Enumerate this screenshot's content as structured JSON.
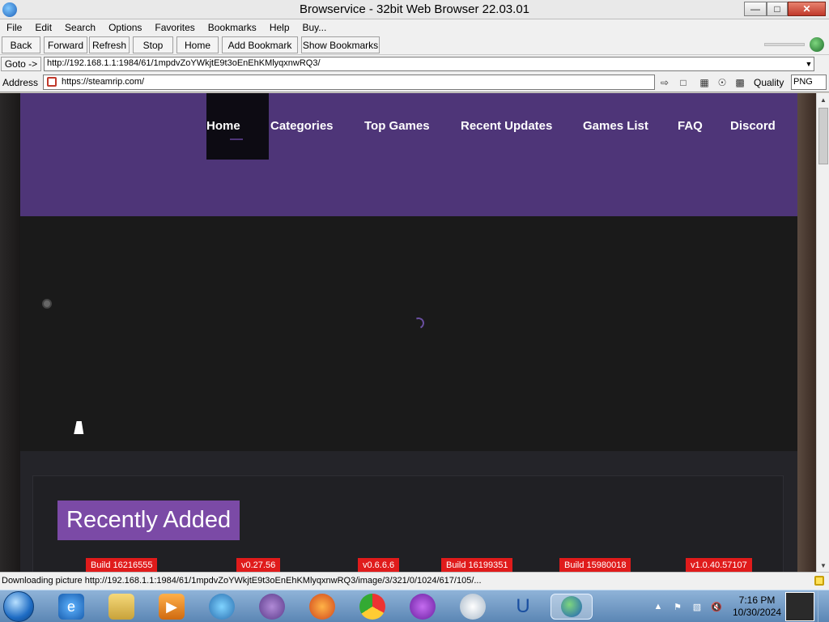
{
  "window": {
    "title": "Browservice - 32bit Web Browser 22.03.01",
    "minimize_icon": "minimize-icon",
    "maximize_icon": "maximize-icon",
    "close_icon": "close-icon"
  },
  "menu": [
    "File",
    "Edit",
    "Search",
    "Options",
    "Favorites",
    "Bookmarks",
    "Help",
    "Buy..."
  ],
  "toolbar": {
    "back": "Back",
    "forward": "Forward",
    "refresh": "Refresh",
    "stop": "Stop",
    "home": "Home",
    "add_bookmark": "Add Bookmark",
    "show_bookmarks": "Show Bookmarks"
  },
  "goto": {
    "button": "Goto ->",
    "value": "http://192.168.1.1:1984/61/1mpdvZoYWkjtE9t3oEnEhKMlyqxnwRQ3/"
  },
  "address": {
    "label": "Address",
    "value": "https://steamrip.com/",
    "quality_label": "Quality",
    "quality_value": "PNG"
  },
  "site": {
    "nav": [
      {
        "label": "Home",
        "active": true
      },
      {
        "label": "Categories"
      },
      {
        "label": "Top Games"
      },
      {
        "label": "Recent Updates"
      },
      {
        "label": "Games List"
      },
      {
        "label": "FAQ"
      },
      {
        "label": "Discord"
      }
    ],
    "section_title": "Recently Added",
    "builds": [
      "Build 16216555",
      "v0.27.56",
      "v0.6.6.6",
      "Build 16199351",
      "Build 15980018",
      "v1.0.40.57107"
    ],
    "colors": {
      "nav_bg": "#4e3578",
      "tag_bg": "#e01b1b",
      "title_bg": "#7b4aa6"
    }
  },
  "status": {
    "text": "Downloading picture http://192.168.1.1:1984/61/1mpdvZoYWkjtE9t3oEnEhKMlyqxnwRQ3/image/3/321/0/1024/617/105/..."
  },
  "taskbar": {
    "time": "7:16 PM",
    "date": "10/30/2024"
  }
}
